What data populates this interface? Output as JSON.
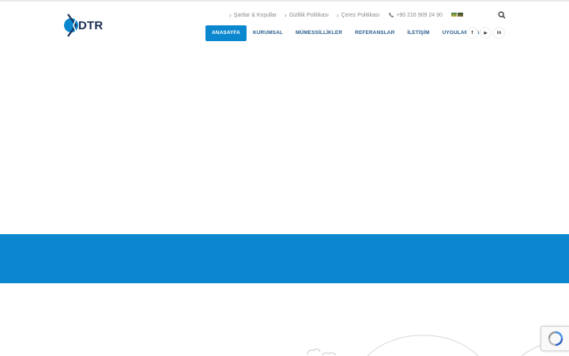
{
  "logo": {
    "text": "DTR",
    "colors": {
      "blue": "#0a87cf",
      "navy": "#1d2f55"
    }
  },
  "top_links": [
    {
      "label": "Şartlar & Koşullar"
    },
    {
      "label": "Gizlilik Politikası"
    },
    {
      "label": "Çerez Politikası"
    }
  ],
  "phone": {
    "number": "+90 216 909 24 90",
    "icon": "phone-icon"
  },
  "flags": [
    "flag-1",
    "flag-2"
  ],
  "search": {
    "icon": "search-icon"
  },
  "nav": [
    {
      "label": "ANASAYFA",
      "active": true
    },
    {
      "label": "KURUMSAL"
    },
    {
      "label": "MÜMESSİLLİKLER"
    },
    {
      "label": "REFERANSLAR"
    },
    {
      "label": "İLETİŞİM"
    },
    {
      "label": "UYGULAMALAR"
    }
  ],
  "social": [
    {
      "label": "f",
      "icon": "facebook-icon"
    },
    {
      "label": "▶",
      "icon": "youtube-icon"
    },
    {
      "label": "in",
      "icon": "linkedin-icon"
    }
  ],
  "colors": {
    "accent": "#0a87cf",
    "nav_text": "#2b5f8f",
    "muted": "#8a8a8a"
  },
  "recaptcha": {
    "icon": "recaptcha-icon"
  }
}
